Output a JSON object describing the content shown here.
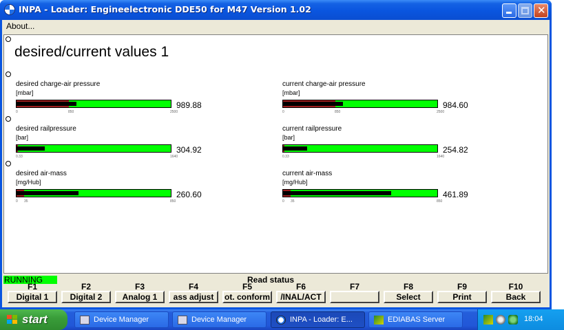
{
  "window": {
    "title": "INPA - Loader:  Engineelectronic DDE50 for M47 Version 1.02",
    "menu": [
      "About..."
    ],
    "buttons": {
      "minimize": "_",
      "maximize": "□",
      "close": "✕"
    }
  },
  "page": {
    "title": "desired/current values 1"
  },
  "gauges": [
    {
      "label": "desired charge-air pressure",
      "unit": "[mbar]",
      "value": "989.88",
      "ticks": [
        "0",
        "850",
        "2500"
      ],
      "fill_fraction": 0.39,
      "marker_fraction": 0.34
    },
    {
      "label": "current charge-air pressure",
      "unit": "[mbar]",
      "value": "984.60",
      "ticks": [
        "0",
        "850",
        "2500"
      ],
      "fill_fraction": 0.39,
      "marker_fraction": 0.34
    },
    {
      "label": "desired railpressure",
      "unit": "[bar]",
      "value": "304.92",
      "ticks": [
        "0.33",
        "1640"
      ],
      "fill_fraction": 0.185,
      "marker_fraction": 0.0
    },
    {
      "label": "current railpressure",
      "unit": "[bar]",
      "value": "254.82",
      "ticks": [
        "0.33",
        "1640"
      ],
      "fill_fraction": 0.155,
      "marker_fraction": 0.0
    },
    {
      "label": "desired air-mass",
      "unit": "[mg/Hub]",
      "value": "260.60",
      "ticks": [
        "0",
        "35",
        "850"
      ],
      "fill_fraction": 0.4,
      "marker_fraction": 0.05
    },
    {
      "label": "current air-mass",
      "unit": "[mg/Hub]",
      "value": "461.89",
      "ticks": [
        "0",
        "35",
        "850"
      ],
      "fill_fraction": 0.7,
      "marker_fraction": 0.05
    }
  ],
  "status": {
    "state": "RUNNING",
    "message": "Read status"
  },
  "function_keys": [
    {
      "key": "F1",
      "label": "Digital 1"
    },
    {
      "key": "F2",
      "label": "Digital 2"
    },
    {
      "key": "F3",
      "label": "Analog 1"
    },
    {
      "key": "F4",
      "label": "ass adjust"
    },
    {
      "key": "F5",
      "label": "ot. conform"
    },
    {
      "key": "F6",
      "label": "/INAL/ACT"
    },
    {
      "key": "F7",
      "label": ""
    },
    {
      "key": "F8",
      "label": "Select"
    },
    {
      "key": "F9",
      "label": "Print"
    },
    {
      "key": "F10",
      "label": "Back"
    }
  ],
  "taskbar": {
    "start": "start",
    "tasks": [
      {
        "label": "Device Manager",
        "icon": "device-manager-icon"
      },
      {
        "label": "Device Manager",
        "icon": "device-manager-icon"
      },
      {
        "label": "INPA - Loader:  E...",
        "icon": "bmw-icon"
      },
      {
        "label": "EDIABAS Server",
        "icon": "ediabas-icon"
      }
    ],
    "clock": "18:04"
  },
  "colors": {
    "gauge_green": "#00ff00",
    "gauge_red": "#a02020",
    "running_green": "#00ff00"
  }
}
